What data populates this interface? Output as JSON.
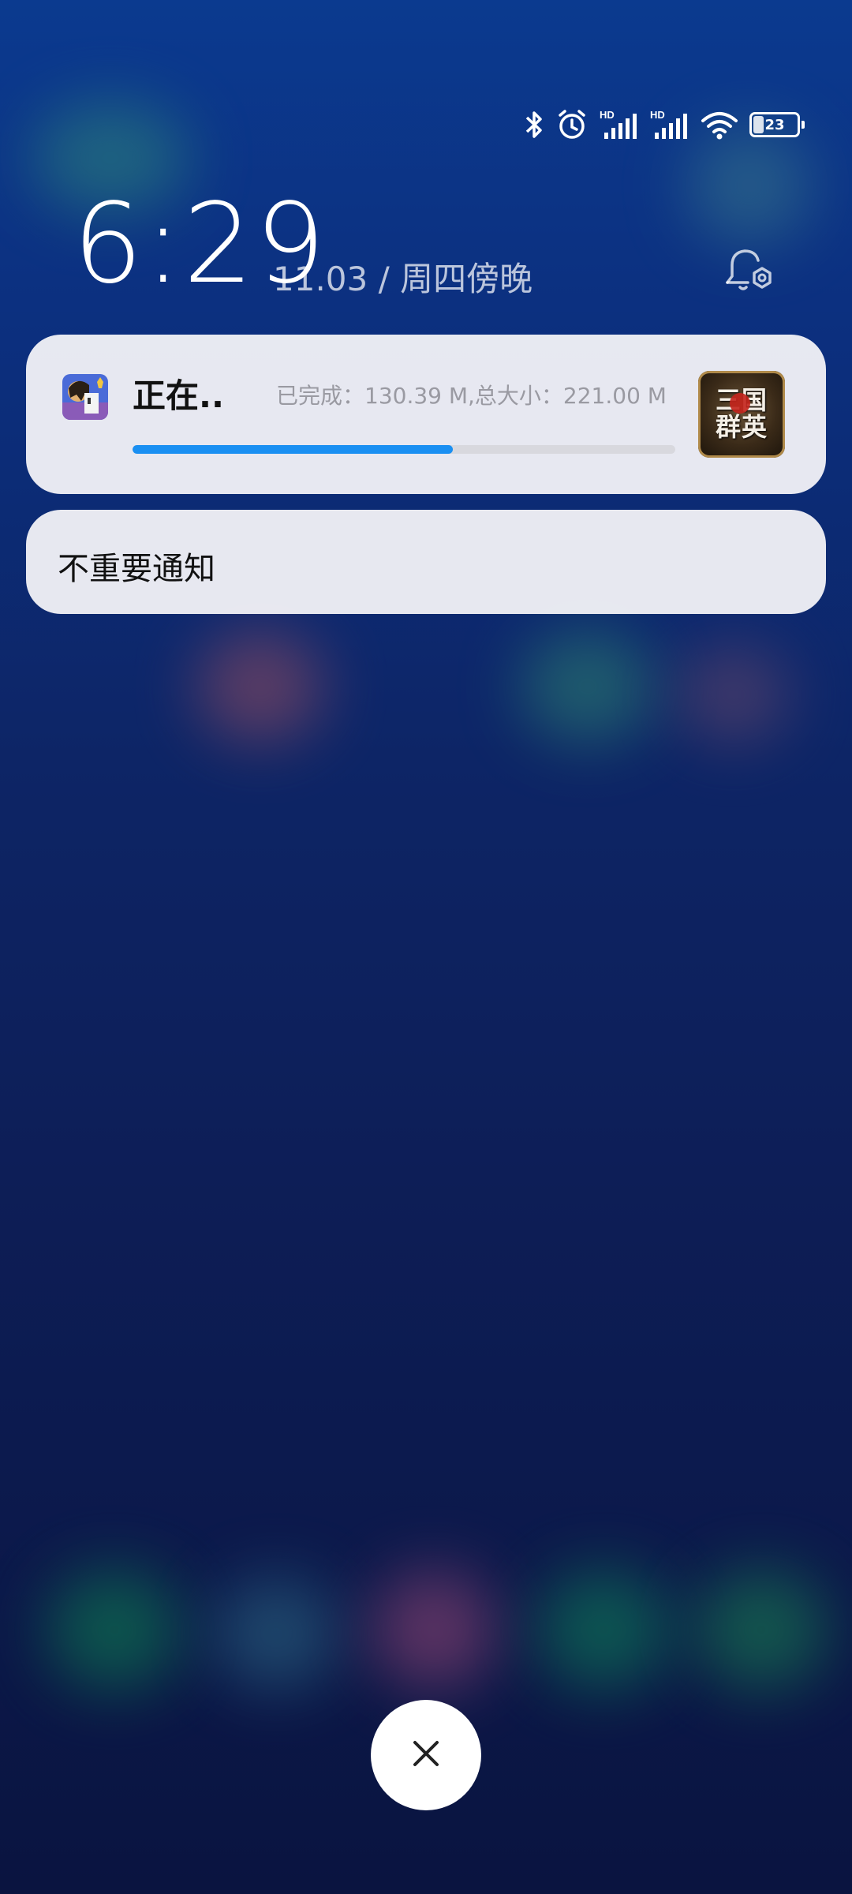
{
  "status_bar": {
    "icons": [
      "bluetooth-icon",
      "alarm-icon",
      "hd-signal-icon",
      "hd-signal-icon",
      "wifi-icon",
      "battery-icon"
    ],
    "hd_label": "HD",
    "battery_level": "23",
    "battery_fraction": 0.23
  },
  "lockscreen": {
    "time": "6:29",
    "date": "11.03 / 周四傍晚",
    "settings_icon": "bell-settings-icon"
  },
  "notifications": [
    {
      "app_icon": "app-icon",
      "title": "正在..",
      "progress_text": "已完成：130.39 M,总大小：221.00 M",
      "progress_fraction": 0.59,
      "thumbnail_text": [
        "三国",
        "群英"
      ],
      "accent": "#1a8ff2"
    },
    {
      "label": "不重要通知"
    }
  ],
  "close_button": {
    "icon": "close-icon"
  },
  "colors": {
    "background_top": "#0b3a8f",
    "background_bottom": "#0a1440",
    "card": "#f0f0f6"
  }
}
